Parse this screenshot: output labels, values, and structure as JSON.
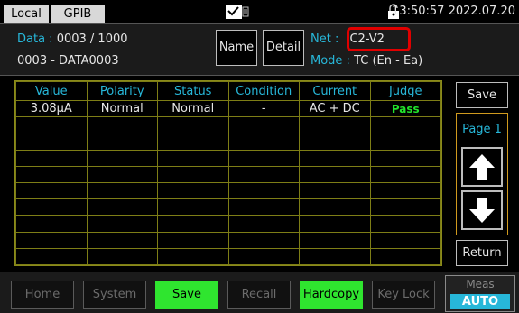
{
  "topbar": {
    "local_label": "Local",
    "gpib_label": "GPIB",
    "clock": "13:50:57 2022.07.20"
  },
  "info": {
    "data_label": "Data :",
    "data_value": "0003 / 1000",
    "data_name": "0003 - DATA0003",
    "name_button": "Name",
    "detail_button": "Detail",
    "net_label": "Net :",
    "net_value": "C2-V2",
    "mode_label": "Mode :",
    "mode_value": "TC (En - Ea)"
  },
  "table": {
    "headers": [
      "Value",
      "Polarity",
      "Status",
      "Condition",
      "Current",
      "Judge"
    ],
    "rows": [
      [
        "3.08µA",
        "Normal",
        "Normal",
        "-",
        "AC + DC",
        "Pass"
      ],
      [
        "",
        "",
        "",
        "",
        "",
        ""
      ],
      [
        "",
        "",
        "",
        "",
        "",
        ""
      ],
      [
        "",
        "",
        "",
        "",
        "",
        ""
      ],
      [
        "",
        "",
        "",
        "",
        "",
        ""
      ],
      [
        "",
        "",
        "",
        "",
        "",
        ""
      ],
      [
        "",
        "",
        "",
        "",
        "",
        ""
      ],
      [
        "",
        "",
        "",
        "",
        "",
        ""
      ],
      [
        "",
        "",
        "",
        "",
        "",
        ""
      ],
      [
        "",
        "",
        "",
        "",
        "",
        ""
      ]
    ]
  },
  "side": {
    "save_label": "Save",
    "page_label": "Page 1",
    "return_label": "Return"
  },
  "bottom": {
    "home": "Home",
    "system": "System",
    "save": "Save",
    "recall": "Recall",
    "hardcopy": "Hardcopy",
    "key_lock": "Key Lock",
    "meas_label": "Meas",
    "meas_value": "AUTO"
  },
  "colors": {
    "accent_cyan": "#27b7d9",
    "pass_green": "#22e22b",
    "highlight_red": "#e10000",
    "grid_olive": "#7e7e16",
    "active_green": "#2fe52f"
  }
}
